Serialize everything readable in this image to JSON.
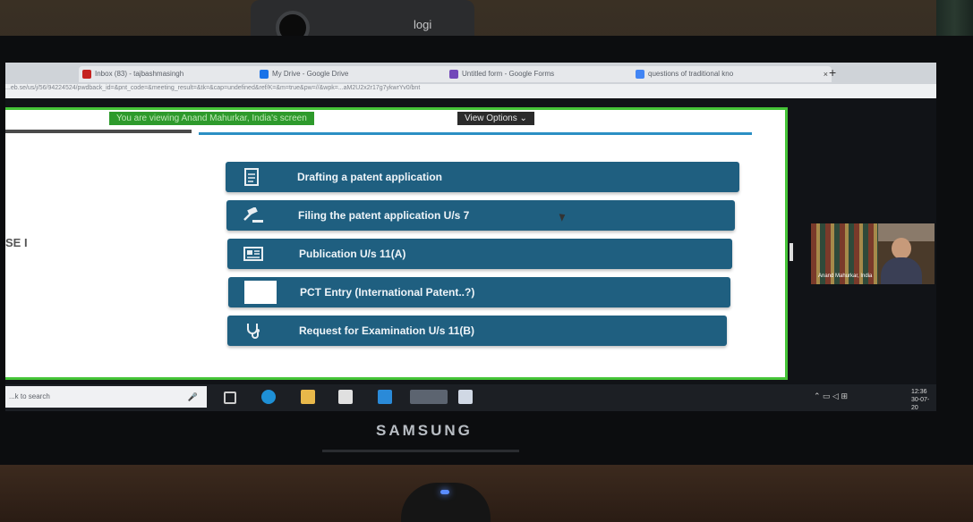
{
  "webcam": {
    "brand": "logi"
  },
  "monitor": {
    "brand": "SAMSUNG"
  },
  "browser": {
    "tabs": [
      {
        "label": "Inbox (83) - tajbashmasingh",
        "color": "#c5221f"
      },
      {
        "label": "My Drive - Google Drive",
        "color": "#1a73e8"
      },
      {
        "label": "Untitled form - Google Forms",
        "color": "#7248b9"
      },
      {
        "label": "questions of traditional kno",
        "color": "#4285f4"
      }
    ],
    "url": "...eb.se/us/j/56/94224524/pwdback_id=&pnt_code=&meeting_result=&tk=&cap=undefined&ref/K=&m=true&pw=//&wpk=...aM2U2x2r17g7ykwrYv0/bnt"
  },
  "share_banner": {
    "viewing_text": "You are viewing Anand Mahurkar, India's screen",
    "view_options_label": "View Options"
  },
  "page": {
    "phase_heading": "SE I",
    "steps": [
      {
        "label": "Drafting a patent application",
        "icon": "document-icon"
      },
      {
        "label": "Filing the patent application U/s 7",
        "icon": "gavel-icon"
      },
      {
        "label": "Publication U/s 11(A)",
        "icon": "newspaper-icon"
      },
      {
        "label": "PCT Entry (International Patent..?)",
        "icon": "blank-icon"
      },
      {
        "label": "Request for Examination U/s 11(B)",
        "icon": "stethoscope-icon"
      }
    ]
  },
  "participant_video": {
    "name": "Anand Mahurkar, India"
  },
  "taskbar": {
    "search_placeholder": "...k to search",
    "time": "12:36",
    "date": "30-07-20"
  }
}
